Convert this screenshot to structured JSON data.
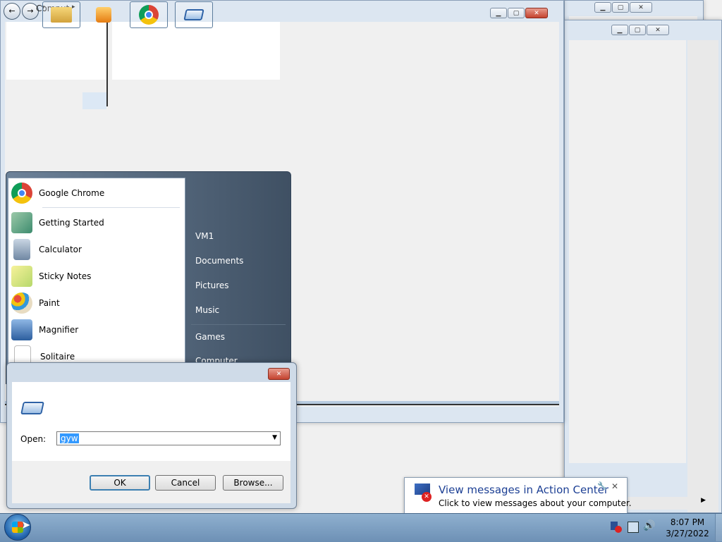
{
  "explorer": {
    "breadcrumb": "Computer",
    "breadcrumb_arrow": "▸"
  },
  "start_menu": {
    "left_items": [
      {
        "label": "Google Chrome",
        "icon": "chrome-icon"
      },
      {
        "label": "Getting Started",
        "icon": "getting-started-icon"
      },
      {
        "label": "Calculator",
        "icon": "calculator-icon"
      },
      {
        "label": "Sticky Notes",
        "icon": "sticky-notes-icon"
      },
      {
        "label": "Paint",
        "icon": "paint-icon"
      },
      {
        "label": "Magnifier",
        "icon": "magnifier-icon"
      },
      {
        "label": "Solitaire",
        "icon": "solitaire-icon"
      }
    ],
    "right_items": [
      {
        "label": "VM1"
      },
      {
        "label": "Documents"
      },
      {
        "label": "Pictures"
      },
      {
        "label": "Music"
      },
      {
        "label": "Games"
      },
      {
        "label": "Computer"
      }
    ]
  },
  "run_dialog": {
    "open_label": "Open:",
    "open_value": "gyw",
    "ok_label": "OK",
    "cancel_label": "Cancel",
    "browse_label": "Browse..."
  },
  "notification": {
    "title": "View messages in Action Center",
    "subtitle": "Click to view messages about your computer."
  },
  "clock": {
    "time": "8:07 PM",
    "date": "3/27/2022"
  },
  "colors": {
    "taskbar": "#7a9cc0",
    "accent": "#3c7fb1",
    "start_menu_right": "#4c5d70"
  }
}
